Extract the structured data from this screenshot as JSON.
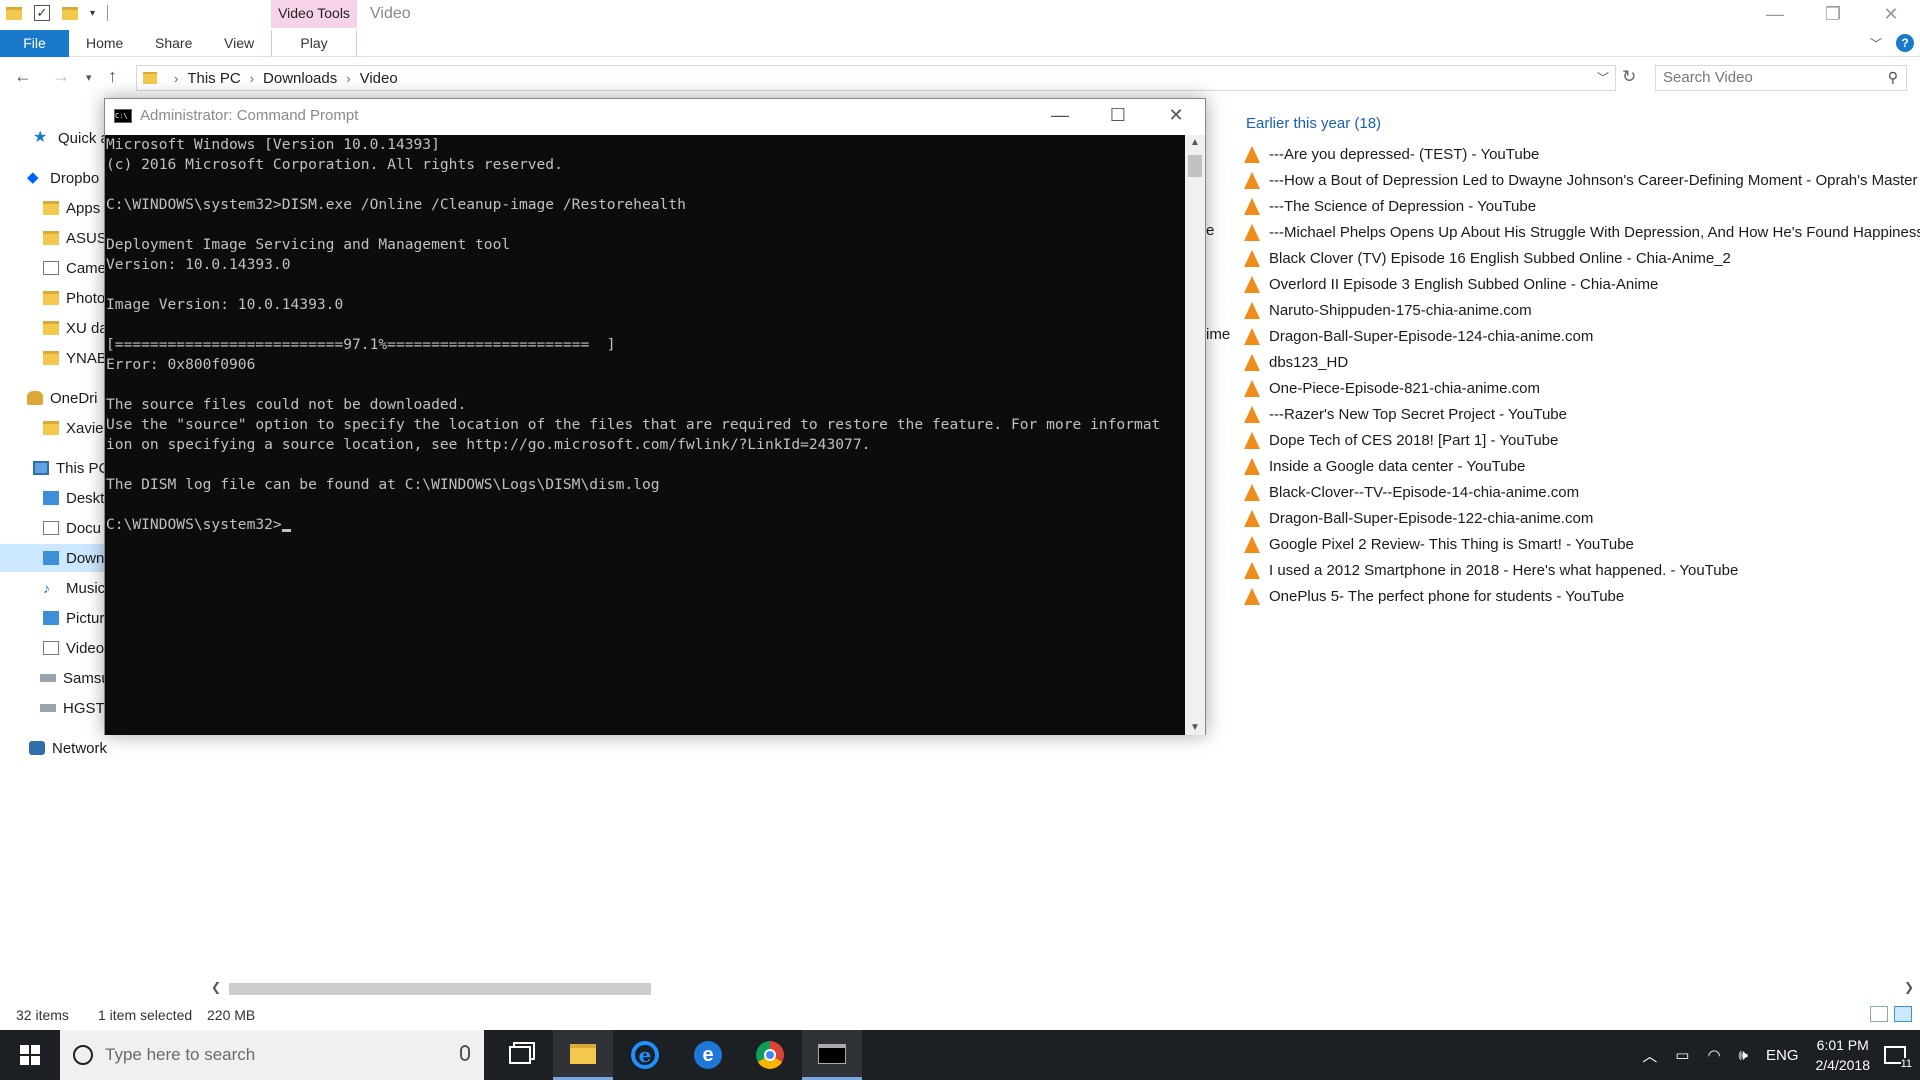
{
  "explorer": {
    "title": "Video",
    "context_tab_group": "Video Tools",
    "ribbon_tabs": [
      "File",
      "Home",
      "Share",
      "View",
      "Play"
    ],
    "breadcrumb": [
      "This PC",
      "Downloads",
      "Video"
    ],
    "search_placeholder": "Search Video",
    "help_label": "?",
    "nav_items": [
      {
        "label": "Quick a",
        "icon": "star-icon"
      },
      {
        "label": "Dropbo",
        "icon": "dropbox-icon"
      },
      {
        "label": "Apps",
        "icon": "folder-icon"
      },
      {
        "label": "ASUS",
        "icon": "folder-icon"
      },
      {
        "label": "Came",
        "icon": "camera-folder-icon"
      },
      {
        "label": "Photo",
        "icon": "folder-icon"
      },
      {
        "label": "XU da",
        "icon": "folder-icon"
      },
      {
        "label": "YNAB",
        "icon": "folder-icon"
      },
      {
        "label": "OneDri",
        "icon": "onedrive-icon"
      },
      {
        "label": "Xavier",
        "icon": "folder-icon"
      },
      {
        "label": "This PC",
        "icon": "pc-icon"
      },
      {
        "label": "Deskto",
        "icon": "desktop-icon"
      },
      {
        "label": "Docu",
        "icon": "documents-icon"
      },
      {
        "label": "Down",
        "icon": "downloads-icon"
      },
      {
        "label": "Music",
        "icon": "music-icon"
      },
      {
        "label": "Picture",
        "icon": "pictures-icon"
      },
      {
        "label": "Video",
        "icon": "videos-icon"
      },
      {
        "label": "Samsu",
        "icon": "drive-icon"
      },
      {
        "label": "HGST",
        "icon": "drive-icon"
      },
      {
        "label": "Network",
        "icon": "network-icon"
      }
    ],
    "group_header": "Earlier this year (18)",
    "files": [
      "---Are you depressed- (TEST) - YouTube",
      "---How a Bout of Depression Led to Dwayne Johnson's Career-Defining Moment - Oprah's Master C",
      "---The Science of Depression - YouTube",
      "---Michael Phelps Opens Up About His Struggle With Depression, And How He's Found Happiness -",
      "Black Clover (TV) Episode 16 English Subbed Online - Chia-Anime_2",
      "Overlord II Episode 3 English Subbed Online - Chia-Anime",
      "Naruto-Shippuden-175-chia-anime.com",
      "Dragon-Ball-Super-Episode-124-chia-anime.com",
      "dbs123_HD",
      "One-Piece-Episode-821-chia-anime.com",
      "---Razer's New Top Secret Project - YouTube",
      "Dope Tech of CES 2018! [Part 1] - YouTube",
      "Inside a Google data center - YouTube",
      "Black-Clover--TV--Episode-14-chia-anime.com",
      "Dragon-Ball-Super-Episode-122-chia-anime.com",
      "Google Pixel 2 Review- This Thing is Smart! - YouTube",
      "I used a 2012 Smartphone in 2018 - Here's what happened. - YouTube",
      "OnePlus 5- The perfect phone for students - YouTube"
    ],
    "partial_texts": [
      "e",
      "ime"
    ],
    "status": {
      "count": "32 items",
      "selection": "1 item selected",
      "size": "220 MB"
    }
  },
  "cmd": {
    "title": "Administrator: Command Prompt",
    "icon_text": "C:\\",
    "lines": [
      "Microsoft Windows [Version 10.0.14393]",
      "(c) 2016 Microsoft Corporation. All rights reserved.",
      "",
      "C:\\WINDOWS\\system32>DISM.exe /Online /Cleanup-image /Restorehealth",
      "",
      "Deployment Image Servicing and Management tool",
      "Version: 10.0.14393.0",
      "",
      "Image Version: 10.0.14393.0",
      "",
      "[==========================97.1%=======================  ]",
      "Error: 0x800f0906",
      "",
      "The source files could not be downloaded.",
      "Use the \"source\" option to specify the location of the files that are required to restore the feature. For more informat",
      "ion on specifying a source location, see http://go.microsoft.com/fwlink/?LinkId=243077.",
      "",
      "The DISM log file can be found at C:\\WINDOWS\\Logs\\DISM\\dism.log",
      "",
      "C:\\WINDOWS\\system32>"
    ]
  },
  "taskbar": {
    "search_placeholder": "Type here to search",
    "apps": [
      "task-view",
      "file-explorer",
      "internet-explorer",
      "edge",
      "chrome",
      "command-prompt"
    ],
    "ie_glyph": "e",
    "edge_glyph": "e",
    "language": "ENG",
    "time": "6:01 PM",
    "date": "2/4/2018",
    "notification_count": "11"
  },
  "colors": {
    "accent": "#1979ca",
    "context_tab": "#f7d3ea",
    "taskbar": "#1c1f24",
    "vlc": "#f08c19"
  }
}
